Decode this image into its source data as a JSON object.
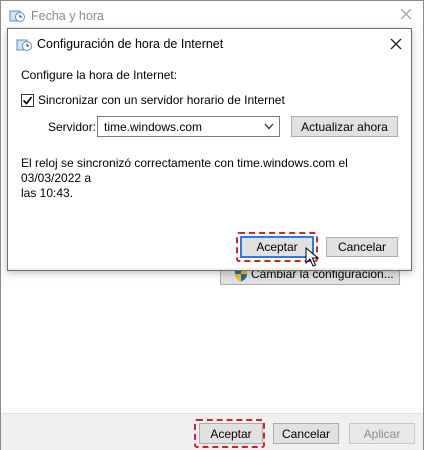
{
  "outer_window": {
    "title": "Fecha y hora",
    "change_settings_label": "Cambiar la configuración...",
    "buttons": {
      "ok": "Aceptar",
      "cancel": "Cancelar",
      "apply": "Aplicar"
    }
  },
  "dialog": {
    "title": "Configuración de hora de Internet",
    "heading": "Configure la hora de Internet:",
    "sync_checkbox": {
      "label": "Sincronizar con un servidor horario de Internet",
      "checked": true
    },
    "server_label": "Servidor:",
    "server_value": "time.windows.com",
    "update_now_label": "Actualizar ahora",
    "status_line1": "El reloj se sincronizó correctamente con time.windows.com el 03/03/2022 a",
    "status_line2": "las 10:43.",
    "buttons": {
      "ok": "Aceptar",
      "cancel": "Cancelar"
    }
  },
  "highlight_color": "#d3232a",
  "focus_color": "#2c7be5"
}
